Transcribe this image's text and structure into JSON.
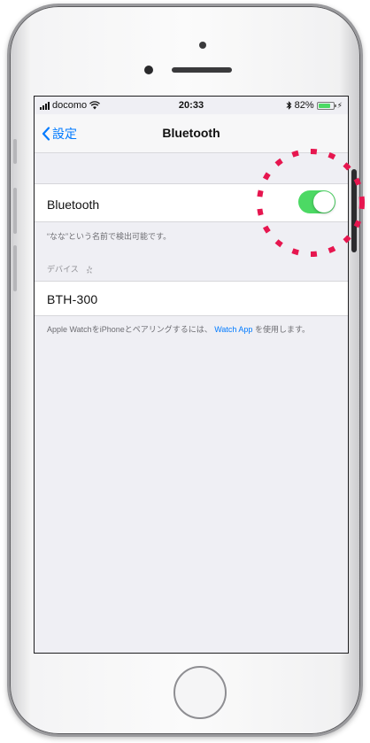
{
  "status_bar": {
    "carrier": "docomo",
    "time": "20:33",
    "battery_percent": "82%",
    "battery_level": 0.82,
    "bluetooth_symbol": "✳",
    "charge_symbol": "⚡"
  },
  "nav": {
    "back_label": "設定",
    "title": "Bluetooth"
  },
  "bluetooth_cell": {
    "label": "Bluetooth",
    "toggle_on": true
  },
  "discoverable_note": "“なな”という名前で検出可能です。",
  "devices_section": {
    "header": "デバイス",
    "devices": [
      "BTH-300"
    ]
  },
  "watch_note": {
    "text_before": "Apple WatchをiPhoneとペアリングするには、",
    "link": "Watch App",
    "text_after": "を使用します。"
  },
  "colors": {
    "accent": "#007aff",
    "toggle_on": "#4cd964",
    "highlight": "#e6164f",
    "background": "#efeff4"
  }
}
